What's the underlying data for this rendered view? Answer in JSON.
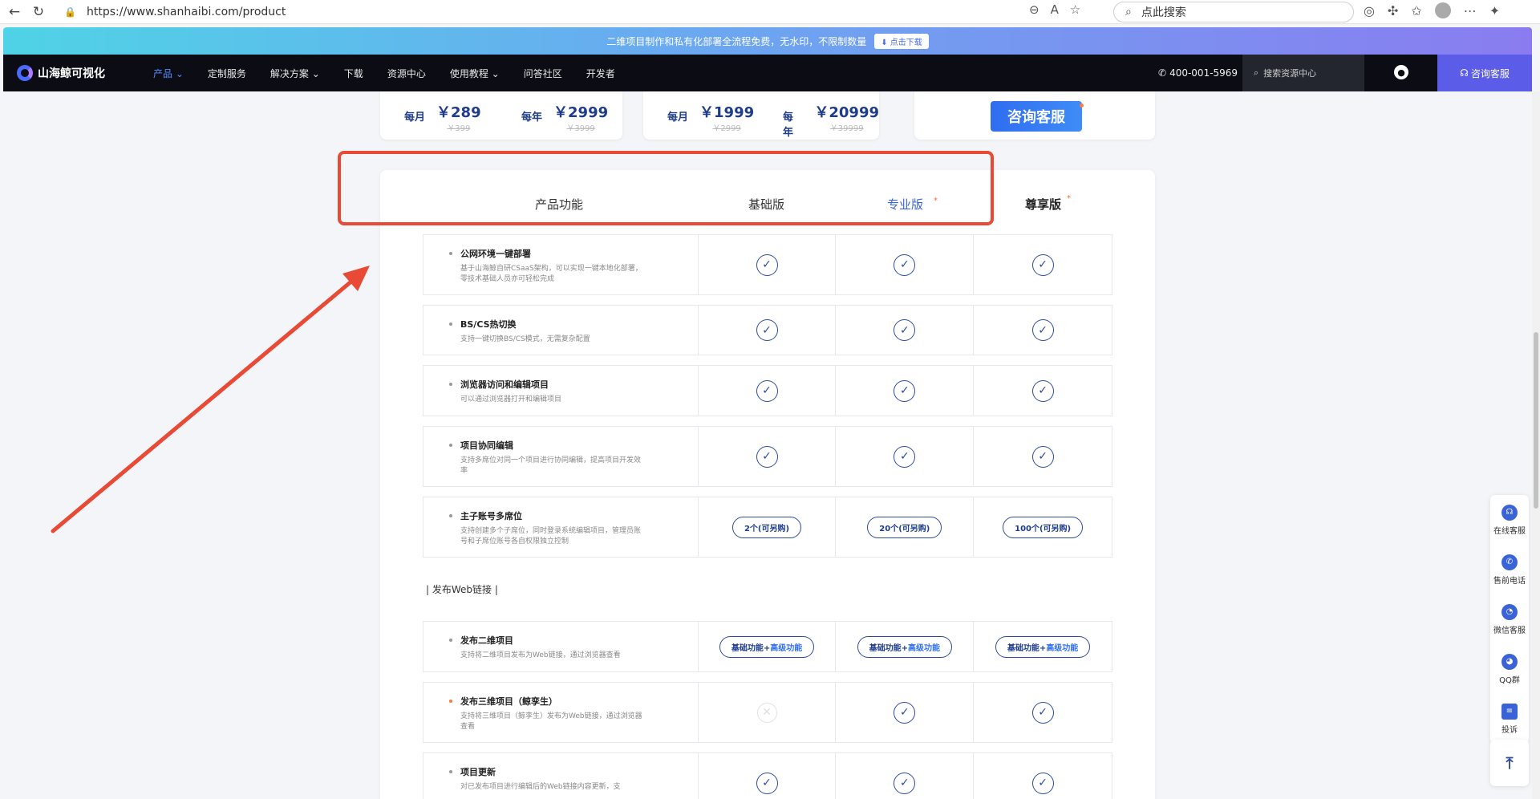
{
  "browser": {
    "url": "https://www.shanhaibi.com/product",
    "search_placeholder": "点此搜索"
  },
  "promo": {
    "text": "二维项目制作和私有化部署全流程免费，无水印，不限制数量",
    "button": "点击下载"
  },
  "nav": {
    "logo": "山海鲸可视化",
    "items": [
      "产品",
      "定制服务",
      "解决方案",
      "下载",
      "资源中心",
      "使用教程",
      "问答社区",
      "开发者"
    ],
    "phone": "400-001-5969",
    "search_placeholder": "搜索资源中心",
    "consult": "咨询客服"
  },
  "pricing": {
    "card1": [
      {
        "period": "每月",
        "price": "￥289",
        "old": "￥399"
      },
      {
        "period": "每年",
        "price": "￥2999",
        "old": "￥3999"
      }
    ],
    "card2": [
      {
        "period": "每月",
        "price": "￥1999",
        "old": "￥2999"
      },
      {
        "period": "每年",
        "price": "￥20999",
        "old": "￥39999"
      }
    ],
    "consult_button": "咨询客服"
  },
  "table": {
    "headers": {
      "feature": "产品功能",
      "basic": "基础版",
      "pro": "专业版",
      "vip": "尊享版"
    },
    "rows": [
      {
        "title": "公网环境一键部署",
        "desc": "基于山海鲸自研CSaaS架构，可以实现一键本地化部署，零技术基础人员亦可轻松完成",
        "cells": [
          "check",
          "check",
          "check"
        ]
      },
      {
        "title": "BS/CS热切换",
        "desc": "支持一键切换BS/CS模式，无需复杂配置",
        "cells": [
          "check",
          "check",
          "check"
        ]
      },
      {
        "title": "浏览器访问和编辑项目",
        "desc": "可以通过浏览器打开和编辑项目",
        "cells": [
          "check",
          "check",
          "check"
        ]
      },
      {
        "title": "项目协同编辑",
        "desc": "支持多席位对同一个项目进行协同编辑，提高项目开发效率",
        "cells": [
          "check",
          "check",
          "check"
        ]
      },
      {
        "title": "主子账号多席位",
        "desc": "支持创建多个子席位，同时登录系统编辑项目，管理员账号和子席位账号各自权限独立控制",
        "cells": [
          "2个(可另购)",
          "20个(可另购)",
          "100个(可另购)"
        ]
      }
    ],
    "section": "| 发布Web链接 |",
    "rows2": [
      {
        "title": "发布二维项目",
        "desc": "支持将二维项目发布为Web链接，通过浏览器查看",
        "cells": [
          "基础功能+高级功能",
          "基础功能+高级功能",
          "基础功能+高级功能"
        ]
      },
      {
        "title": "发布三维项目（鲸孪生）",
        "desc": "支持将三维项目（鲸孪生）发布为Web链接，通过浏览器查看",
        "cells": [
          "x",
          "check",
          "check"
        ]
      },
      {
        "title": "项目更新",
        "desc": "对已发布项目进行编辑后的Web链接内容更新，支",
        "cells": [
          "check",
          "check",
          "check"
        ]
      }
    ],
    "pill_prefix": "基础功能+",
    "pill_highlight": "高级功能"
  },
  "sidebar": {
    "items": [
      "在线客服",
      "售前电话",
      "微信客服",
      "QQ群",
      "投诉"
    ]
  },
  "colors": {
    "accent": "#3a63d8",
    "annotation": "#e84a35",
    "nav_bg": "#0c0d14"
  }
}
